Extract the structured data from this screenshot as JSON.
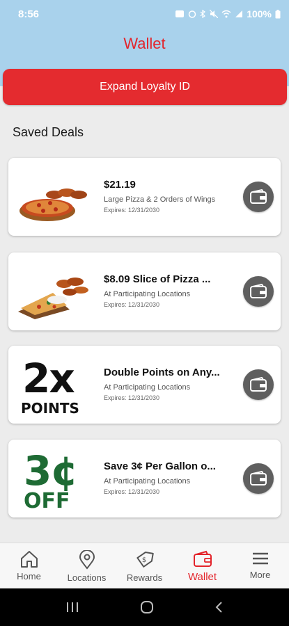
{
  "status_bar": {
    "time": "8:56",
    "battery_text": "100%"
  },
  "header": {
    "title": "Wallet",
    "background": "#a9d2ec",
    "title_color": "#e3242b"
  },
  "loyalty_button": {
    "label": "Expand Loyalty ID",
    "color": "#e42b2f"
  },
  "saved_deals": {
    "title": "Saved Deals",
    "items": [
      {
        "title": "$21.19",
        "subtitle": "Large Pizza & 2 Orders of Wings",
        "expires": "Expires: 12/31/2030",
        "image": "pizza-and-wings-image"
      },
      {
        "title": "$8.09 Slice of Pizza ...",
        "subtitle": "At Participating Locations",
        "expires": "Expires: 12/31/2030",
        "image": "slice-and-wings-image"
      },
      {
        "title": "Double Points on Any...",
        "subtitle": "At Participating Locations",
        "expires": "Expires: 12/31/2030",
        "image": "2x-points-graphic",
        "promo_big": "2x",
        "promo_small": "POINTS"
      },
      {
        "title": "Save 3¢ Per Gallon o...",
        "subtitle": "At Participating Locations",
        "expires": "Expires: 12/31/2030",
        "image": "3-cent-off-graphic",
        "promo_big": "3¢",
        "promo_small": "OFF",
        "promo_color": "#1e6b34"
      }
    ]
  },
  "bottom_nav": {
    "items": [
      {
        "label": "Home",
        "icon": "home-icon"
      },
      {
        "label": "Locations",
        "icon": "location-pin-icon"
      },
      {
        "label": "Rewards",
        "icon": "rewards-tag-icon"
      },
      {
        "label": "Wallet",
        "icon": "wallet-icon",
        "active": true
      },
      {
        "label": "More",
        "icon": "menu-icon"
      }
    ]
  }
}
